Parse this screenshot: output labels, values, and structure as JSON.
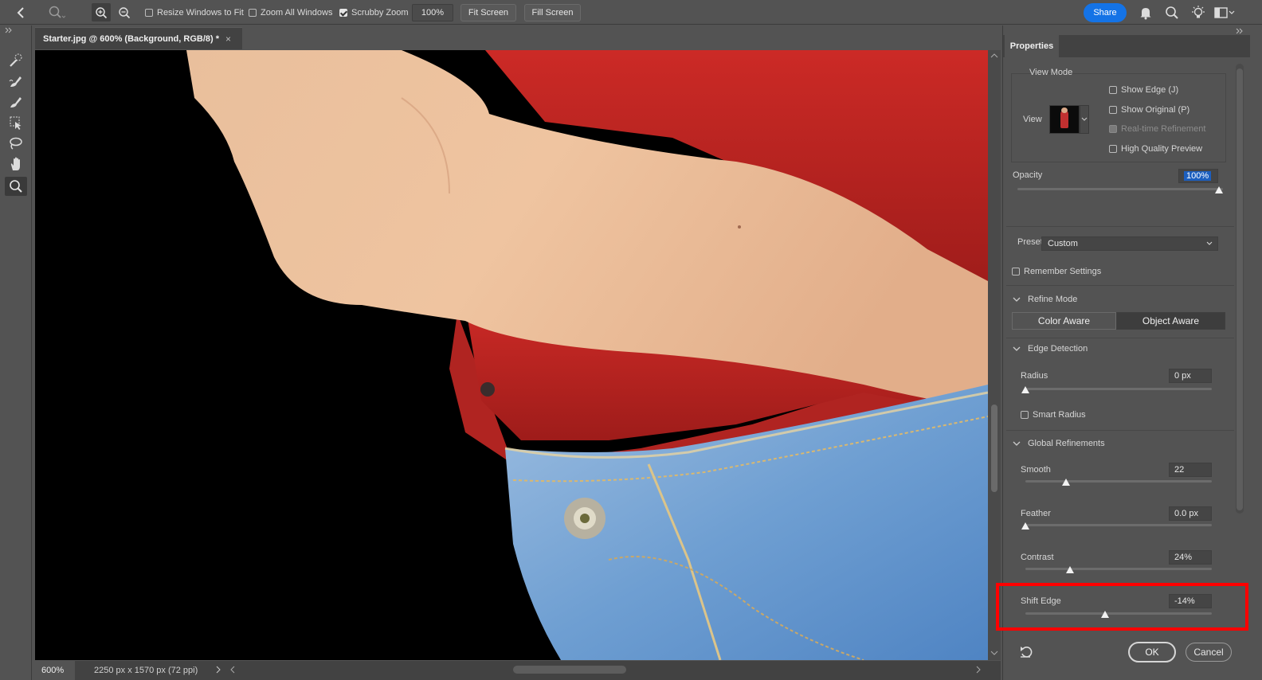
{
  "options_bar": {
    "resize_windows": "Resize Windows to Fit",
    "zoom_all": "Zoom All Windows",
    "scrubby_zoom": "Scrubby Zoom",
    "zoom_value": "100%",
    "fit_screen": "Fit Screen",
    "fill_screen": "Fill Screen",
    "share": "Share"
  },
  "document": {
    "tab_title": "Starter.jpg @ 600% (Background, RGB/8) *",
    "close": "×",
    "status_zoom": "600%",
    "status_info": "2250 px x 1570 px (72 ppi)"
  },
  "properties": {
    "tab": "Properties",
    "view_mode": {
      "heading": "View Mode",
      "view_label": "View",
      "show_edge": "Show Edge (J)",
      "show_original": "Show Original (P)",
      "realtime": "Real-time Refinement",
      "hq_preview": "High Quality Preview"
    },
    "opacity": {
      "label": "Opacity",
      "value": "100%",
      "level": 1.0
    },
    "preset": {
      "label": "Preset",
      "value": "Custom"
    },
    "remember": "Remember Settings",
    "refine_mode": {
      "heading": "Refine Mode",
      "color_aware": "Color Aware",
      "object_aware": "Object Aware"
    },
    "edge_detection": {
      "heading": "Edge Detection",
      "radius_label": "Radius",
      "radius_value": "0 px",
      "radius_level": 0.0,
      "smart_radius": "Smart Radius"
    },
    "global_refinements": {
      "heading": "Global Refinements",
      "smooth_label": "Smooth",
      "smooth_value": "22",
      "smooth_level": 0.22,
      "feather_label": "Feather",
      "feather_value": "0.0 px",
      "feather_level": 0.0,
      "contrast_label": "Contrast",
      "contrast_value": "24%",
      "contrast_level": 0.24,
      "shift_label": "Shift Edge",
      "shift_value": "-14%",
      "shift_level": 0.43
    },
    "ok": "OK",
    "cancel": "Cancel"
  }
}
